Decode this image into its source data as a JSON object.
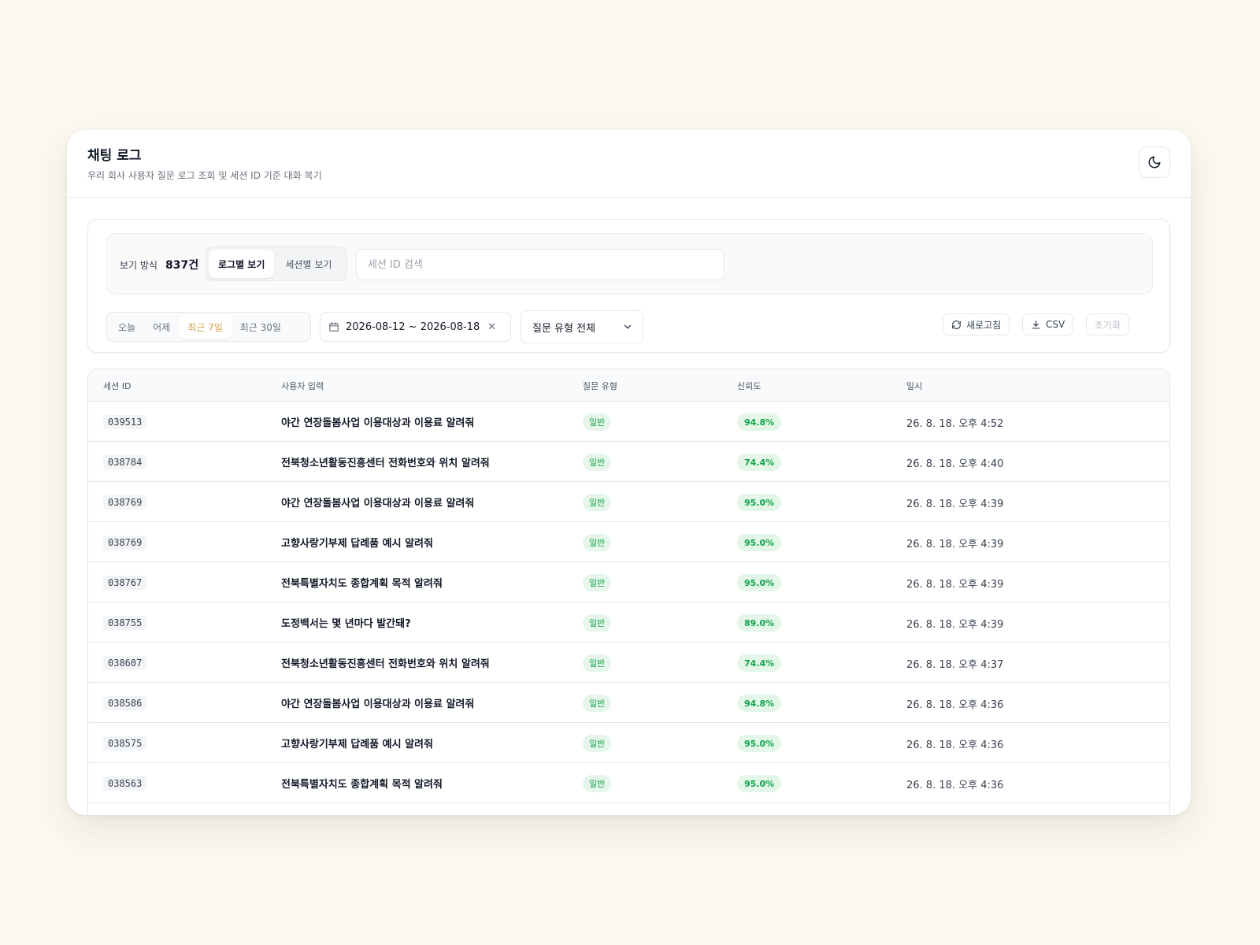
{
  "header": {
    "title": "채팅 로그",
    "subtitle": "우리 회사 사용자 질문 로그 조회 및 세션 ID 기준 대화 복기",
    "theme_icon": "moon-icon"
  },
  "view": {
    "label": "보기 방식",
    "count": "837건",
    "modes": [
      "로그별 보기",
      "세션별 보기"
    ],
    "active_mode": "로그별 보기",
    "search_placeholder": "세션 ID 검색"
  },
  "filters": {
    "ranges": [
      "오늘",
      "어제",
      "최근 7일",
      "최근 30일"
    ],
    "active_range": "최근 7일",
    "date_range": "2026-08-12 ~ 2026-08-18",
    "type_select": "질문 유형 전체",
    "refresh_label": "새로고침",
    "csv_label": "CSV",
    "reset_label": "초기화",
    "accent_color": "#d4a24c"
  },
  "table": {
    "columns": [
      "세션 ID",
      "사용자 입력",
      "질문 유형",
      "신뢰도",
      "일시"
    ],
    "rows": [
      {
        "session_id": "039513",
        "input": "야간 연장돌봄사업 이용대상과 이용료 알려줘",
        "type": "일반",
        "confidence": "94.8%",
        "datetime": "26. 8. 18. 오후 4:52"
      },
      {
        "session_id": "038784",
        "input": "전북청소년활동진흥센터 전화번호와 위치 알려줘",
        "type": "일반",
        "confidence": "74.4%",
        "datetime": "26. 8. 18. 오후 4:40"
      },
      {
        "session_id": "038769",
        "input": "야간 연장돌봄사업 이용대상과 이용료 알려줘",
        "type": "일반",
        "confidence": "95.0%",
        "datetime": "26. 8. 18. 오후 4:39"
      },
      {
        "session_id": "038769",
        "input": "고향사랑기부제 답례품 예시 알려줘",
        "type": "일반",
        "confidence": "95.0%",
        "datetime": "26. 8. 18. 오후 4:39"
      },
      {
        "session_id": "038767",
        "input": "전북특별자치도 종합계획 목적 알려줘",
        "type": "일반",
        "confidence": "95.0%",
        "datetime": "26. 8. 18. 오후 4:39"
      },
      {
        "session_id": "038755",
        "input": "도정백서는 몇 년마다 발간돼?",
        "type": "일반",
        "confidence": "89.0%",
        "datetime": "26. 8. 18. 오후 4:39"
      },
      {
        "session_id": "038607",
        "input": "전북청소년활동진흥센터 전화번호와 위치 알려줘",
        "type": "일반",
        "confidence": "74.4%",
        "datetime": "26. 8. 18. 오후 4:37"
      },
      {
        "session_id": "038586",
        "input": "야간 연장돌봄사업 이용대상과 이용료 알려줘",
        "type": "일반",
        "confidence": "94.8%",
        "datetime": "26. 8. 18. 오후 4:36"
      },
      {
        "session_id": "038575",
        "input": "고향사랑기부제 답례품 예시 알려줘",
        "type": "일반",
        "confidence": "95.0%",
        "datetime": "26. 8. 18. 오후 4:36"
      },
      {
        "session_id": "038563",
        "input": "전북특별자치도 종합계획 목적 알려줘",
        "type": "일반",
        "confidence": "95.0%",
        "datetime": "26. 8. 18. 오후 4:36"
      }
    ]
  }
}
